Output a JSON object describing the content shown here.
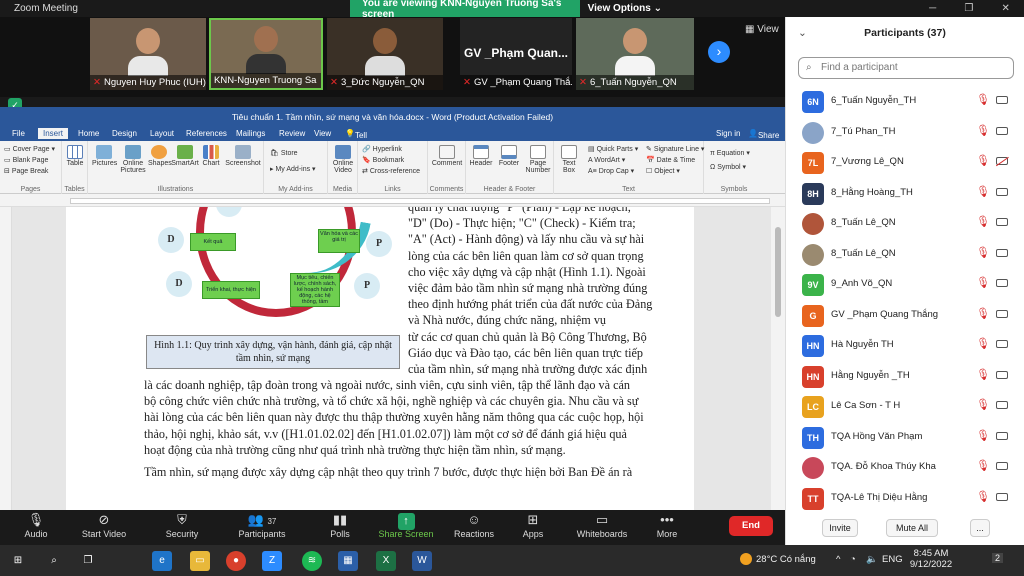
{
  "zoom": {
    "window_title": "Zoom Meeting",
    "banner_text": "You are viewing KNN-Nguyen Truong Sa's screen",
    "view_options": "View Options",
    "view_label": "View",
    "win_controls": [
      "─",
      "❐",
      "✕"
    ]
  },
  "video_tiles": [
    {
      "name": "Nguyen Huy Phuc (IUH)",
      "active": false,
      "overlay": ""
    },
    {
      "name": "KNN-Nguyen Truong Sa",
      "active": true,
      "overlay": ""
    },
    {
      "name": "3_Đức Nguyễn_QN",
      "active": false,
      "overlay": ""
    },
    {
      "name": "GV _Phạm Quang Thắ...",
      "active": false,
      "overlay": "GV _Phạm Quan..."
    },
    {
      "name": "6_Tuấn Nguyễn_QN",
      "active": false,
      "overlay": ""
    }
  ],
  "word": {
    "title": "Tiêu chuẩn 1. Tầm nhìn, sứ mạng và văn hóa.docx - Word (Product Activation Failed)",
    "search_hint": "Tell me what you want to do...",
    "sign_in": "Sign in",
    "share": "Share",
    "tabs": [
      "File",
      "Insert",
      "Home",
      "Design",
      "Layout",
      "References",
      "Mailings",
      "Review",
      "View"
    ],
    "active_tab": "Insert",
    "ribbon": {
      "pages": {
        "label": "Pages",
        "items": [
          "Cover Page",
          "Blank Page",
          "Page Break"
        ]
      },
      "tables": {
        "label": "Tables",
        "items": [
          "Table"
        ]
      },
      "illustrations": {
        "label": "Illustrations",
        "items": [
          "Pictures",
          "Online Pictures",
          "Shapes",
          "SmartArt",
          "Chart",
          "Screenshot"
        ]
      },
      "addins": {
        "label": "My Add-ins",
        "items": [
          "Store",
          "My Add-ins"
        ]
      },
      "media": {
        "label": "Media",
        "items": [
          "Online Video"
        ]
      },
      "links": {
        "label": "Links",
        "items": [
          "Hyperlink",
          "Bookmark",
          "Cross-reference"
        ]
      },
      "comments": {
        "label": "Comments",
        "items": [
          "Comment"
        ]
      },
      "header_footer": {
        "label": "Header & Footer",
        "items": [
          "Header",
          "Footer",
          "Page Number"
        ]
      },
      "text": {
        "label": "Text",
        "items": [
          "Text Box",
          "Quick Parts",
          "WordArt",
          "Drop Cap",
          "Signature Line",
          "Date & Time",
          "Object"
        ]
      },
      "symbols": {
        "label": "Symbols",
        "items": [
          "Equation",
          "Symbol"
        ]
      }
    },
    "diagram": {
      "labels": [
        "Kết quả",
        "Văn hóa và các giá trị",
        "Triển khai, thực hiện",
        "Mục tiêu, chiến lược, chính sách, kế hoạch hành động, các hệ thống, tầm"
      ],
      "letters": [
        "D",
        "P",
        "D",
        "P",
        "C"
      ]
    },
    "caption": "Hình 1.1: Quy trình xây dựng, vận hành, đánh giá, cập nhật tầm nhìn, sứ mạng",
    "text_right": [
      "quản lý chất lượng \"P\" (Plan) - Lập kế hoạch;",
      "\"D\" (Do) - Thực hiện; \"C\" (Check) - Kiểm tra;",
      "\"A\" (Act) - Hành động) và lấy nhu cầu và sự hài",
      "lòng của các bên liên quan làm cơ sở quan trọng",
      "cho việc xây dựng và cập nhật (Hình 1.1). Ngoài",
      "việc đảm bảo tầm nhìn sứ mạng nhà trường đúng",
      "theo định hướng phát triển của đất nước của Đảng",
      "và Nhà nước, đúng chức năng, nhiệm vụ",
      "từ các cơ quan chủ quản là Bộ Công Thương, Bộ",
      "Giáo dục và Đào tạo, các bên liên quan trực tiếp",
      "của tầm nhìn, sứ mạng nhà trường được xác định"
    ],
    "text_full": [
      "là các doanh nghiệp, tập đoàn trong và ngoài nước, sinh viên, cựu sinh viên, tập thể lãnh đạo và cán",
      "bộ công chức viên chức nhà trường, và tổ chức xã hội, nghề nghiệp và các chuyên gia. Nhu cầu và sự",
      "hài lòng của các bên liên quan này được thu thập thường xuyên hằng năm thông qua các cuộc họp, hội",
      "thảo, hội nghị, khảo sát, v.v ([H1.01.02.02] đến [H1.01.02.07]) làm một cơ sở để đánh giá hiệu quả",
      "hoạt động của nhà trường cũng như quá trình nhà trường thực hiện tầm nhìn, sứ mạng."
    ],
    "text_last": "Tầm nhìn, sứ mạng được xây dựng cập nhật theo quy trình 7 bước, được thực hiện bởi Ban Đề án rà"
  },
  "participants": {
    "title": "Participants (37)",
    "search_placeholder": "Find a participant",
    "list": [
      {
        "initials": "6N",
        "color": "#2d6cdf",
        "name": "6_Tuấn Nguyễn_TH",
        "cam_off": false
      },
      {
        "initials": "",
        "color": "#8aa4c8",
        "name": "7_Tú Phan_TH",
        "cam_off": false
      },
      {
        "initials": "7L",
        "color": "#e8641e",
        "name": "7_Vương Lê_QN",
        "cam_off": true
      },
      {
        "initials": "8H",
        "color": "#2a3a5a",
        "name": "8_Hằng Hoàng_TH",
        "cam_off": false
      },
      {
        "initials": "",
        "color": "#b0553a",
        "name": "8_Tuấn Lê_QN",
        "cam_off": false
      },
      {
        "initials": "",
        "color": "#9a8a70",
        "name": "8_Tuấn Lê_QN",
        "cam_off": false
      },
      {
        "initials": "9V",
        "color": "#3bb34a",
        "name": "9_Anh Võ_QN",
        "cam_off": false
      },
      {
        "initials": "G",
        "color": "#e8641e",
        "name": "GV _Phạm Quang Thắng",
        "cam_off": false
      },
      {
        "initials": "HN",
        "color": "#2d6cdf",
        "name": "Hà Nguyễn TH",
        "cam_off": false
      },
      {
        "initials": "HN",
        "color": "#d8402c",
        "name": "Hằng Nguyễn _TH",
        "cam_off": false
      },
      {
        "initials": "LC",
        "color": "#e8a21e",
        "name": "Lê Ca Sơn - T H",
        "cam_off": false
      },
      {
        "initials": "TH",
        "color": "#2d6cdf",
        "name": "TQA Hồng Văn Phạm",
        "cam_off": false
      },
      {
        "initials": "",
        "color": "#c8485a",
        "name": "TQA. Đỗ Khoa Thúy Kha",
        "cam_off": false
      },
      {
        "initials": "TT",
        "color": "#d8402c",
        "name": "TQA-Lê Thị Diệu Hằng",
        "cam_off": false
      }
    ],
    "invite": "Invite",
    "mute_all": "Mute All",
    "more": "..."
  },
  "toolbar": {
    "items": [
      "Audio",
      "Start Video",
      "Security",
      "Participants",
      "Polls",
      "Share Screen",
      "Reactions",
      "Apps",
      "Whiteboards",
      "More"
    ],
    "participant_count": "37",
    "end": "End"
  },
  "taskbar": {
    "weather": "28°C Có nắng",
    "lang": "ENG",
    "time": "8:45 AM",
    "date": "9/12/2022",
    "notif": "2"
  }
}
